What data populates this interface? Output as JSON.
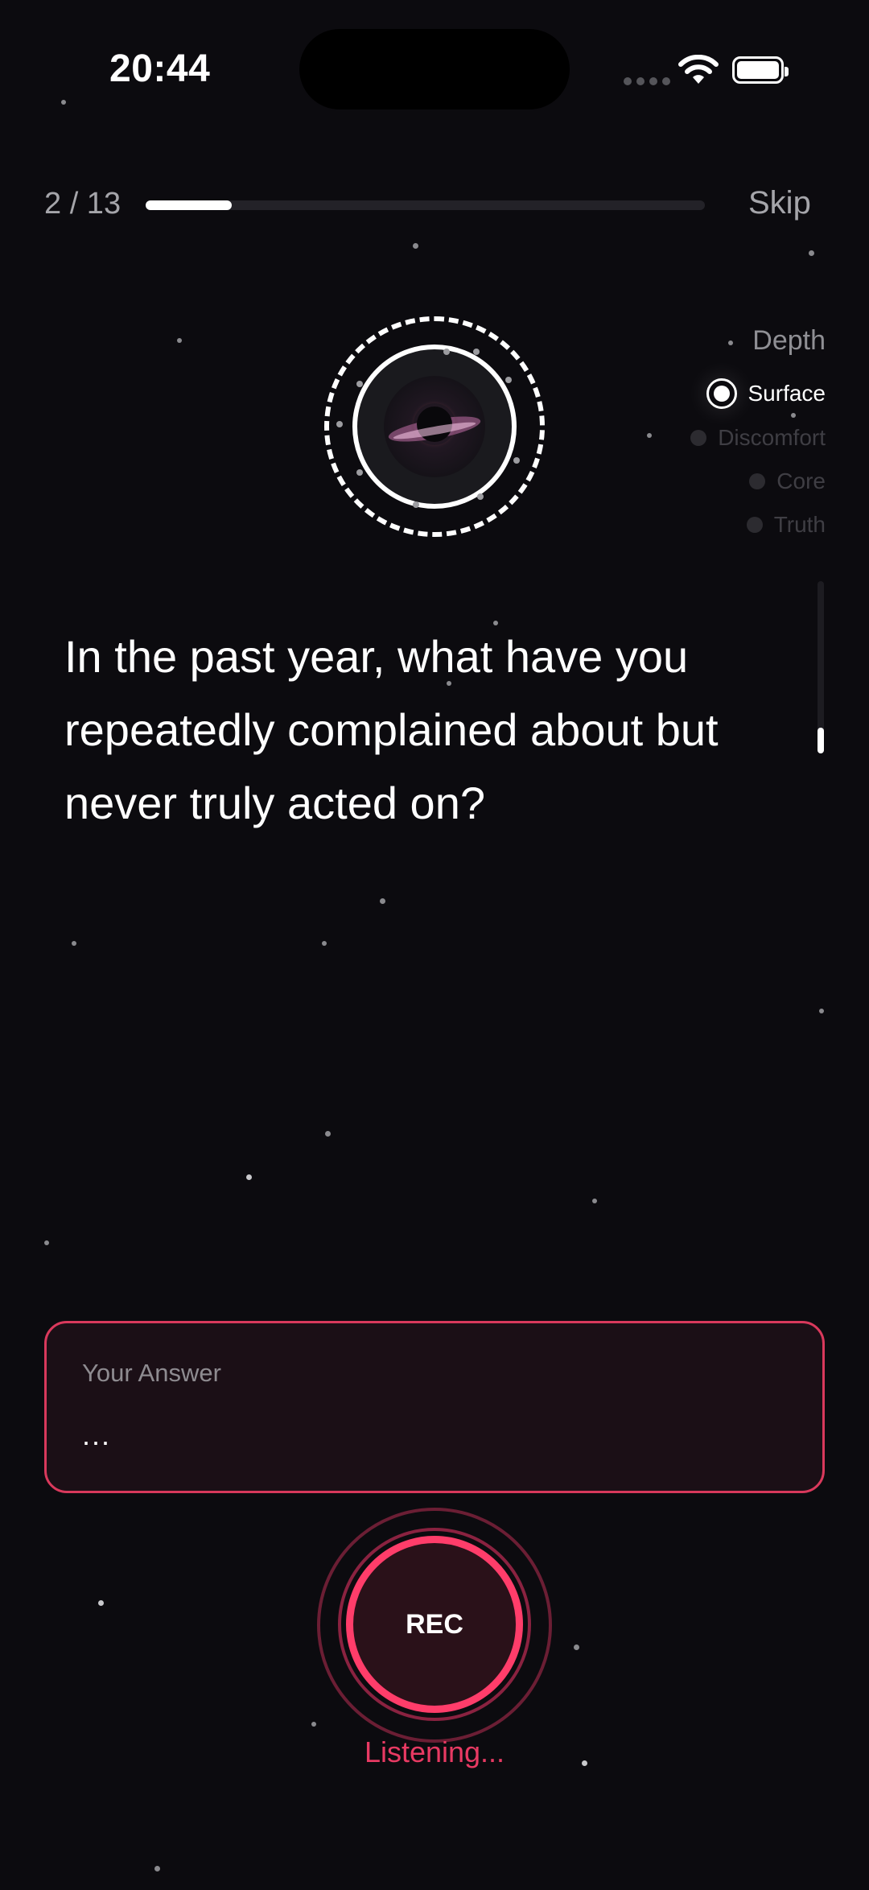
{
  "status_bar": {
    "time": "20:44"
  },
  "progress": {
    "label": "2 / 13",
    "current": 2,
    "total": 13,
    "fill_fraction": 0.154,
    "skip_label": "Skip"
  },
  "depth": {
    "title": "Depth",
    "items": [
      {
        "label": "Surface",
        "active": true
      },
      {
        "label": "Discomfort",
        "active": false
      },
      {
        "label": "Core",
        "active": false
      },
      {
        "label": "Truth",
        "active": false
      }
    ]
  },
  "question": {
    "text": "In the past year, what have you repeatedly complained about but never truly acted on?"
  },
  "answer": {
    "label": "Your Answer",
    "value": "..."
  },
  "recorder": {
    "button_label": "REC",
    "status": "Listening..."
  },
  "colors": {
    "accent": "#ff3d6a",
    "background": "#0c0b0f",
    "answer_border": "#d9395c"
  },
  "icons": [
    "wifi-icon",
    "battery-icon",
    "cellular-icon",
    "orb-icon"
  ]
}
